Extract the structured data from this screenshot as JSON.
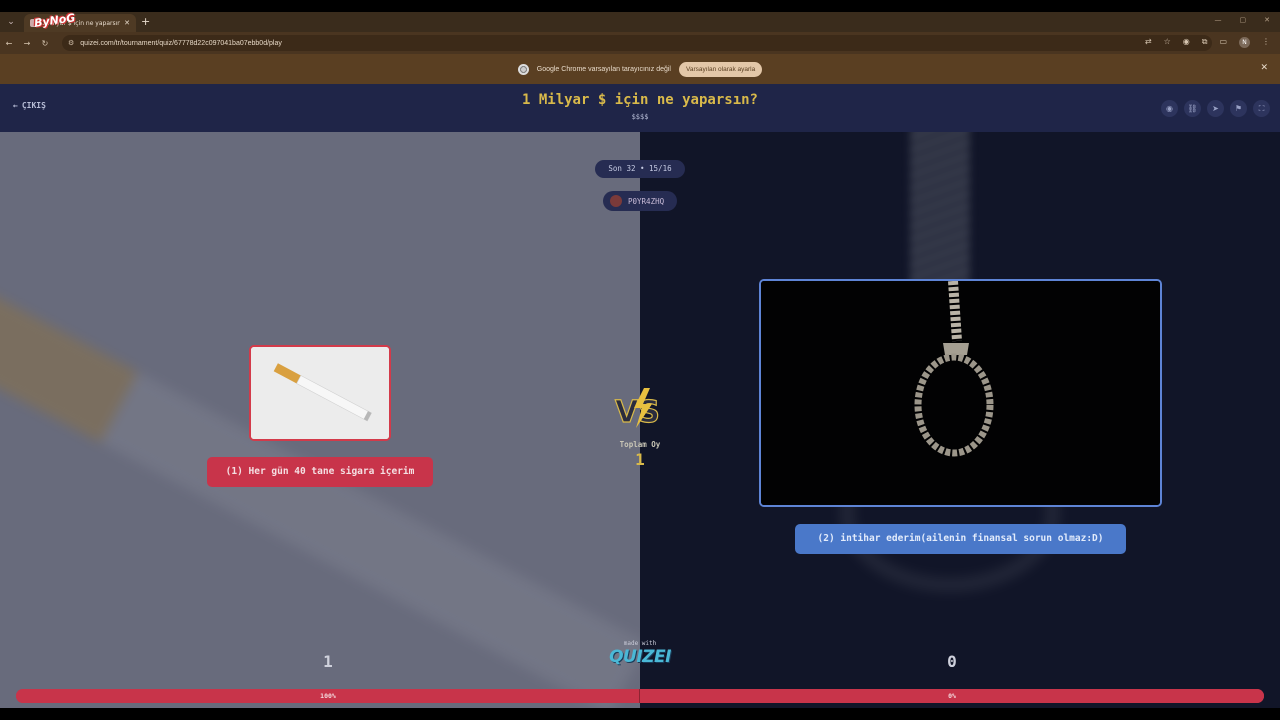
{
  "browser": {
    "tab_title": "1 Milyar $ için ne yaparsın? - Q...",
    "tab_overlay_text": "ByNoG",
    "url": "quizei.com/tr/tournament/quiz/67778d22c097041ba07ebb0d/play",
    "infobar_text": "Google Chrome varsayılan tarayıcınız değil",
    "infobar_button": "Varsayılan olarak ayarla",
    "profile_initial": "N"
  },
  "header": {
    "exit_label": "ÇIKIŞ",
    "title": "1 Milyar $ için ne yaparsın?",
    "subtitle": "$$$$"
  },
  "round": {
    "label": "Son 32 • 15/16",
    "username": "P0YR4ZHQ"
  },
  "left": {
    "option_label": "(1) Her gün 40 tane sigara içerim",
    "votes": "1",
    "percent_label": "100%",
    "percent": 100,
    "color": "#c8344a"
  },
  "right": {
    "option_label": "(2) intihar ederim(ailenin finansal sorun olmaz:D)",
    "votes": "0",
    "percent_label": "0%",
    "percent": 0,
    "color": "#4a78c9"
  },
  "center": {
    "vs_text": "VS",
    "total_label": "Toplam Oy",
    "total_value": "1",
    "made_with": "made with",
    "brand": "QUIZEI"
  }
}
